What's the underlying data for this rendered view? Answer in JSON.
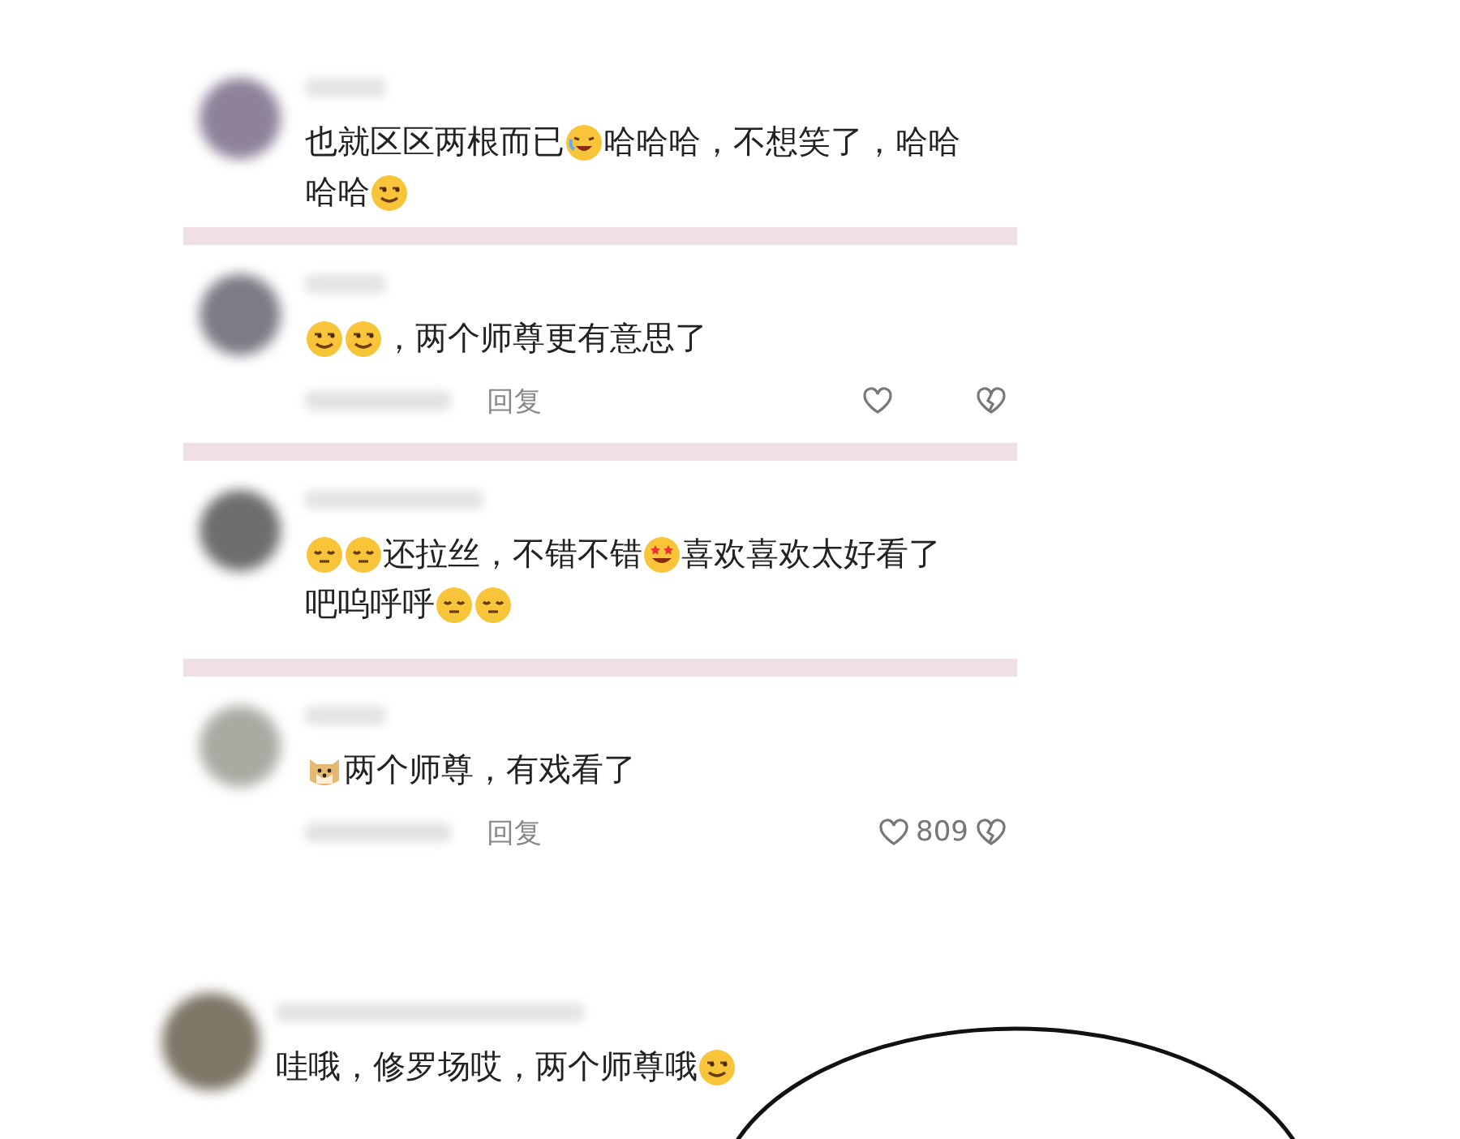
{
  "comments": [
    {
      "color": "#8d8299",
      "lines": [
        [
          {
            "kind": "text",
            "text": "也就区区两根而已"
          },
          {
            "kind": "laughcry"
          },
          {
            "kind": "text",
            "text": "哈哈哈，不想笑了，哈哈"
          }
        ],
        [
          {
            "kind": "text",
            "text": "哈哈"
          },
          {
            "kind": "smug"
          }
        ]
      ]
    },
    {
      "color": "#7c7c86",
      "lines": [
        [
          {
            "kind": "smug"
          },
          {
            "kind": "smug"
          },
          {
            "kind": "text",
            "text": "，两个师尊更有意思了"
          }
        ]
      ],
      "footer": {
        "reply": "回复"
      }
    },
    {
      "color": "#6e6e70",
      "lines": [
        [
          {
            "kind": "relieved"
          },
          {
            "kind": "relieved"
          },
          {
            "kind": "text",
            "text": "还拉丝，不错不错"
          },
          {
            "kind": "stareyes"
          },
          {
            "kind": "text",
            "text": "喜欢喜欢太好看了"
          }
        ],
        [
          {
            "kind": "text",
            "text": "吧呜呼呼"
          },
          {
            "kind": "relieved"
          },
          {
            "kind": "relieved"
          }
        ]
      ]
    },
    {
      "color": "#a9aba3",
      "lines": [
        [
          {
            "kind": "doge"
          },
          {
            "kind": "text",
            "text": "两个师尊，有戏看了"
          }
        ]
      ],
      "footer": {
        "reply": "回复",
        "likes": "809"
      }
    }
  ],
  "last_comment": {
    "color": "#7d7566",
    "lines": [
      [
        {
          "kind": "text",
          "text": "哇哦，修罗场哎，两个师尊哦"
        },
        {
          "kind": "smug"
        }
      ]
    ]
  }
}
